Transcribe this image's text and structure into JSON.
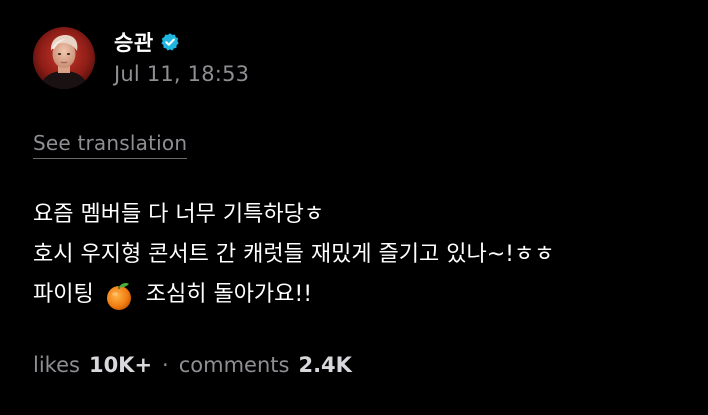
{
  "author": {
    "name": "승관",
    "verified": true,
    "accent_color": "#1fb6e0"
  },
  "post": {
    "timestamp": "Jul 11, 18:53",
    "translate_label": "See translation",
    "lines": [
      "요즘 멤버들 다 너무 기특하당ㅎ",
      "호시 우지형 콘서트 간 캐럿들 재밌게 즐기고 있나~!ㅎㅎ"
    ],
    "last_line_before_emoji": "파이팅",
    "emoji": "orange-icon",
    "last_line_after_emoji": "조심히 돌아가요!!"
  },
  "stats": {
    "likes_label": "likes",
    "likes_value": "10K+",
    "separator": "·",
    "comments_label": "comments",
    "comments_value": "2.4K"
  }
}
